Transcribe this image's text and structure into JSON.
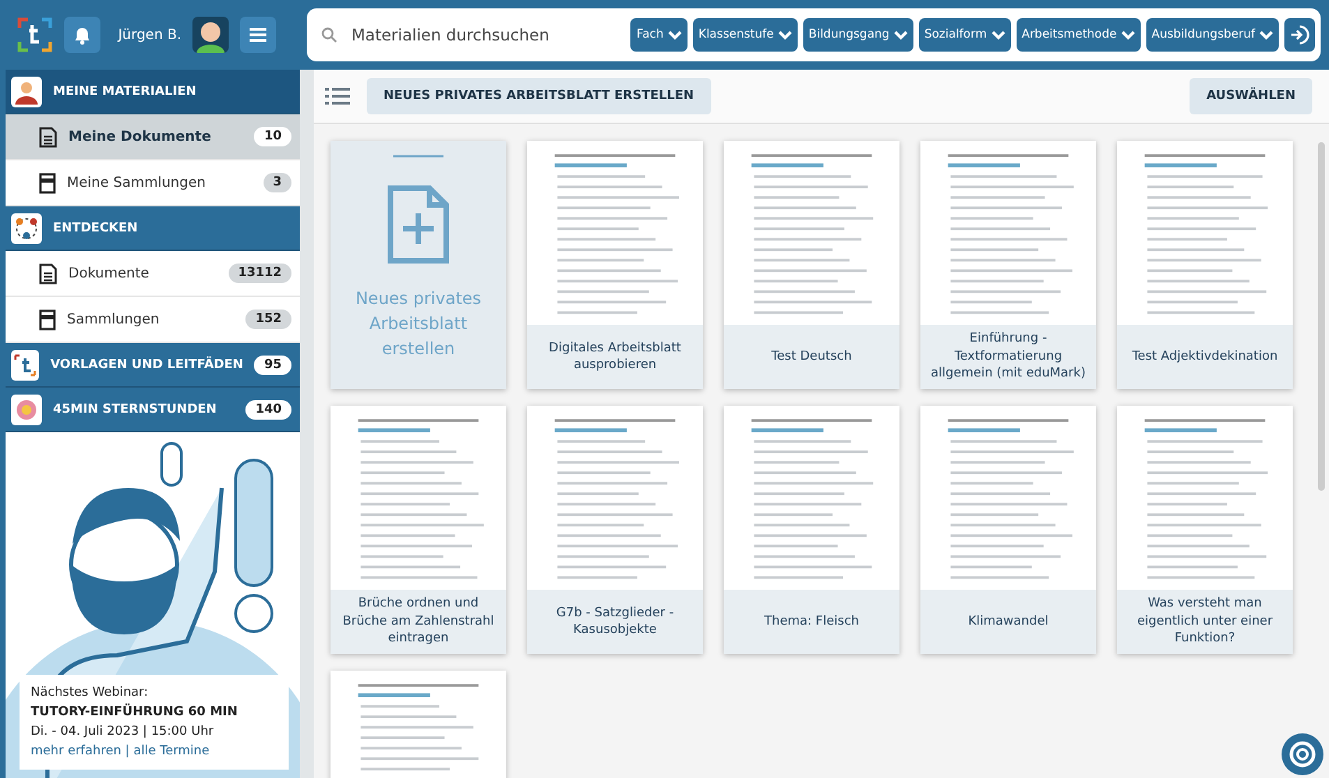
{
  "header": {
    "user_name": "Jürgen B.",
    "search": {
      "placeholder": "Materialien durchsuchen"
    },
    "filters": [
      "Fach",
      "Klassenstufe",
      "Bildungsgang",
      "Sozialform",
      "Arbeitsmethode",
      "Ausbildungsberuf"
    ]
  },
  "sidebar": {
    "items": [
      {
        "kind": "section",
        "label": "MEINE MATERIALIEN",
        "selected": false
      },
      {
        "kind": "item",
        "label": "Meine Dokumente",
        "count": "10",
        "selected": true
      },
      {
        "kind": "item",
        "label": "Meine Sammlungen",
        "count": "3",
        "selected": false
      },
      {
        "kind": "section",
        "label": "ENTDECKEN",
        "selected": false
      },
      {
        "kind": "item",
        "label": "Dokumente",
        "count": "13112",
        "selected": false
      },
      {
        "kind": "item",
        "label": "Sammlungen",
        "count": "152",
        "selected": false
      },
      {
        "kind": "section",
        "label": "VORLAGEN UND LEITFÄDEN",
        "count": "95",
        "selected": false
      },
      {
        "kind": "section",
        "label": "45MIN STERNSTUNDEN",
        "count": "140",
        "selected": false
      }
    ]
  },
  "webinar": {
    "heading": "Nächstes Webinar:",
    "title": "TUTORY-EINFÜHRUNG 60 MIN",
    "date": "Di. - 04. Juli 2023 | 15:00 Uhr",
    "link": "mehr erfahren | alle Termine"
  },
  "toolbar": {
    "new_button": "NEUES PRIVATES ARBEITSBLATT ERSTELLEN",
    "select_button": "AUSWÄHLEN"
  },
  "cards": [
    {
      "kind": "new",
      "title": "Neues privates Arbeitsblatt erstellen"
    },
    {
      "kind": "worksheet",
      "title": "Digitales Arbeitsblatt ausprobieren"
    },
    {
      "kind": "worksheet",
      "title": "Test Deutsch"
    },
    {
      "kind": "worksheet",
      "title": "Einführung - Textformatierung allgemein (mit eduMark)"
    },
    {
      "kind": "worksheet",
      "title": "Test Adjektivdekination"
    },
    {
      "kind": "worksheet",
      "title": "Brüche ordnen und Brüche am Zahlenstrahl eintragen"
    },
    {
      "kind": "worksheet",
      "title": "G7b - Satzglieder - Kasusobjekte"
    },
    {
      "kind": "worksheet",
      "title": "Thema: Fleisch"
    },
    {
      "kind": "worksheet",
      "title": "Klimawandel"
    },
    {
      "kind": "worksheet",
      "title": "Was versteht man eigentlich unter einer Funktion?"
    },
    {
      "kind": "worksheet"
    }
  ]
}
